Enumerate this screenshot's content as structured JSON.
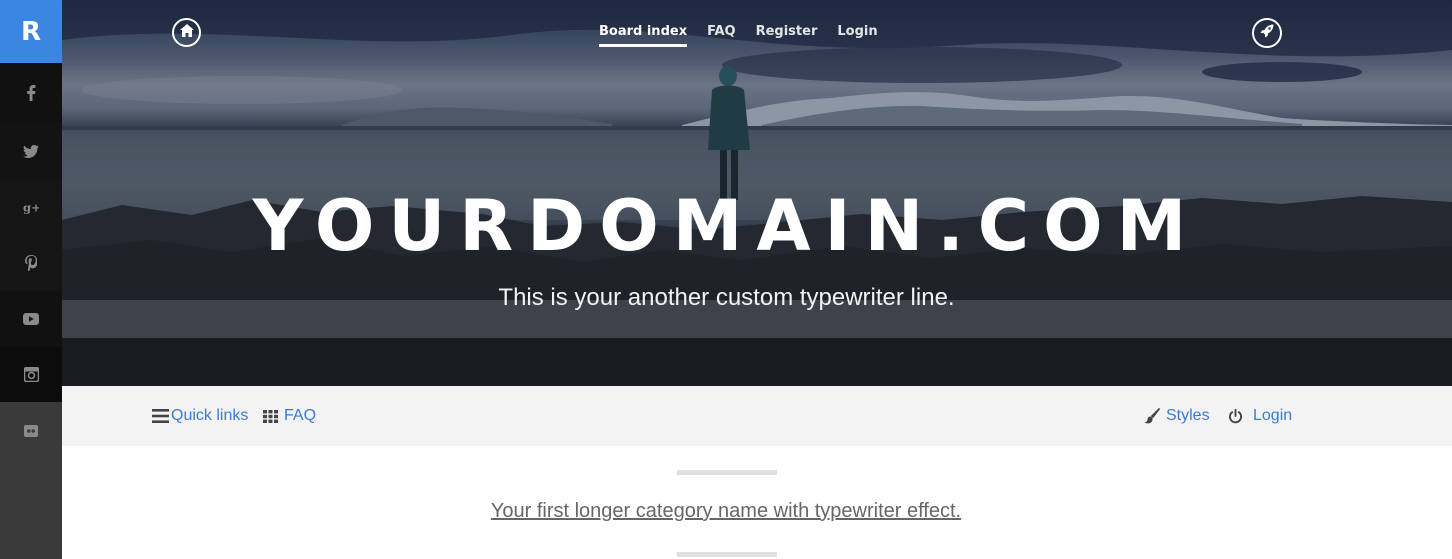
{
  "brand": {
    "logo_letter": "R",
    "accent": "#3b86e0"
  },
  "sidebar": {
    "social_items": [
      {
        "name": "facebook-icon",
        "glyph": "f"
      },
      {
        "name": "twitter-icon",
        "glyph": "🐦"
      },
      {
        "name": "google-plus-icon",
        "glyph": "g+"
      },
      {
        "name": "pinterest-icon",
        "glyph": "p"
      },
      {
        "name": "youtube-icon",
        "glyph": "▶"
      },
      {
        "name": "instagram-icon",
        "glyph": "◙"
      },
      {
        "name": "flickr-icon",
        "glyph": "••"
      }
    ]
  },
  "hero": {
    "nav": {
      "items": [
        {
          "label": "Board index",
          "active": true
        },
        {
          "label": "FAQ",
          "active": false
        },
        {
          "label": "Register",
          "active": false
        },
        {
          "label": "Login",
          "active": false
        }
      ]
    },
    "title": "YOURDOMAIN.COM",
    "subtitle": "This is your another custom typewriter line.",
    "left_icon": "home-icon",
    "right_icon": "rocket-icon"
  },
  "toolbar": {
    "quick_links": "Quick links",
    "faq": "FAQ",
    "styles": "Styles",
    "login": "Login",
    "link_color": "#3b7bd4"
  },
  "content": {
    "category_title": "Your first longer category name with typewriter effect."
  }
}
